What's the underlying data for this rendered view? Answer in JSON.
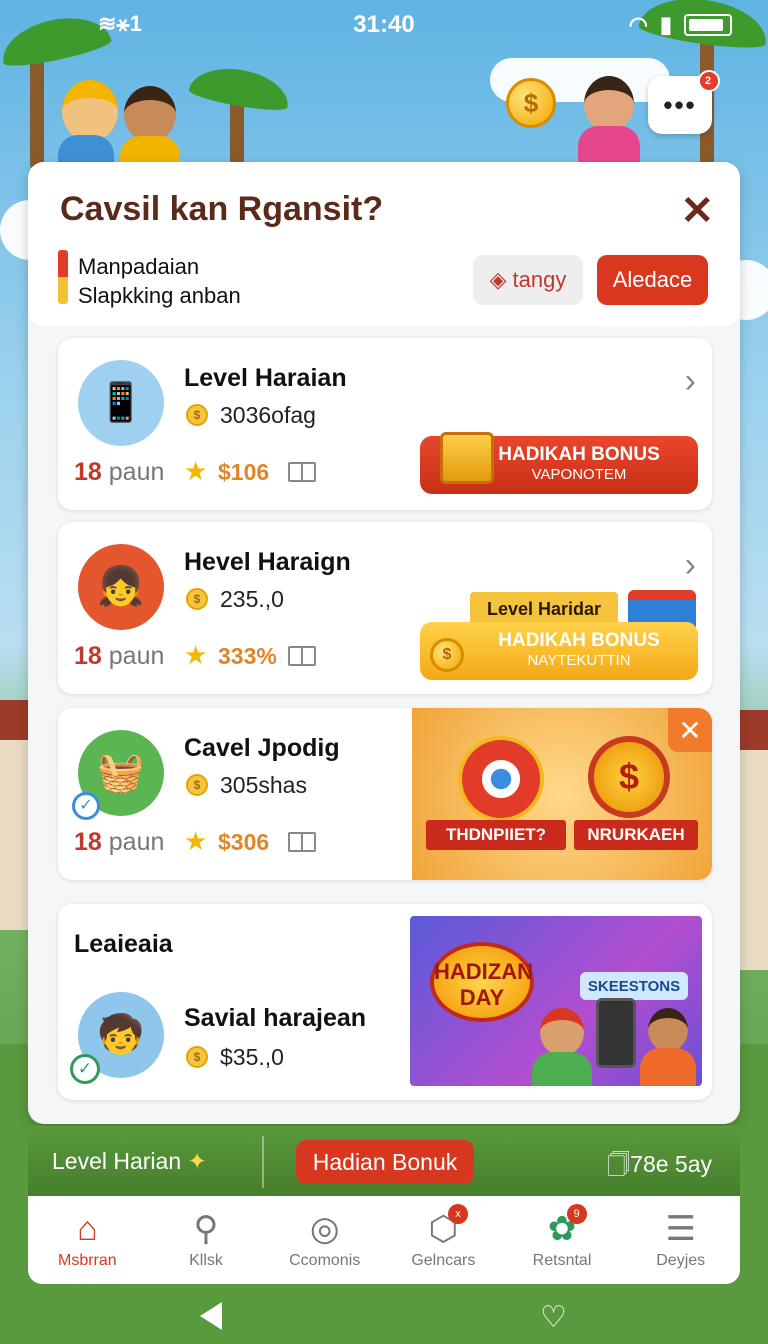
{
  "status": {
    "left": "≋⚹1",
    "time": "31:40"
  },
  "hero": {
    "coin_symbol": "$",
    "more": "•••",
    "more_badge": "2"
  },
  "dialog": {
    "title": "Cavsil kan Rgansit?",
    "close": "✕",
    "sub_line1": "Manpadaian",
    "sub_line2": "Slapkking anban",
    "btn_tangy": "tangy",
    "btn_aledace": "Aledace"
  },
  "cards": [
    {
      "title": "Level Haraian",
      "value": "3036ofag",
      "points": "18",
      "points_unit": "paun",
      "price": "$106",
      "bonus_title": "HADIKAH BONUS",
      "bonus_sub": "VAPONOTEM"
    },
    {
      "title": "Hevel Haraign",
      "value": "235.,0",
      "points": "18",
      "points_unit": "paun",
      "price": "333%",
      "level_tag": "Level Haridar",
      "bonus_title": "HADIKAH BONUS",
      "bonus_sub": "NAYTEKUTTIN"
    },
    {
      "title": "Cavel Jpodig",
      "value": "305shas",
      "points": "18",
      "points_unit": "paun",
      "price": "$306",
      "ribbon_left": "THDNPIIET?",
      "ribbon_right": "NRURKAEH",
      "promo_close": "✕"
    },
    {
      "section": "Leaieaia",
      "title": "Savial harajean",
      "value": "$35.,0",
      "day_badge_line1": "HADIZAN",
      "day_badge_line2": "DAY",
      "tag": "SKEESTONS"
    }
  ],
  "strip": {
    "left": "Level Harian",
    "left_icon": "✦",
    "button": "Hadian Bonuk",
    "right": "🗍78e   5ay"
  },
  "tabs": [
    {
      "label": "Msbrran",
      "icon": "⌂",
      "active": true
    },
    {
      "label": "Kllsk",
      "icon": "⚲"
    },
    {
      "label": "Ccomonis",
      "icon": "◎"
    },
    {
      "label": "Gelncars",
      "icon": "⬡",
      "badge": "x"
    },
    {
      "label": "Retsntal",
      "icon": "✿",
      "badge": "9"
    },
    {
      "label": "Deyjes",
      "icon": "☰"
    }
  ],
  "colors": {
    "accent": "#d8371f",
    "title_brown": "#5a2b1a",
    "coin_gold": "#f5c542"
  }
}
